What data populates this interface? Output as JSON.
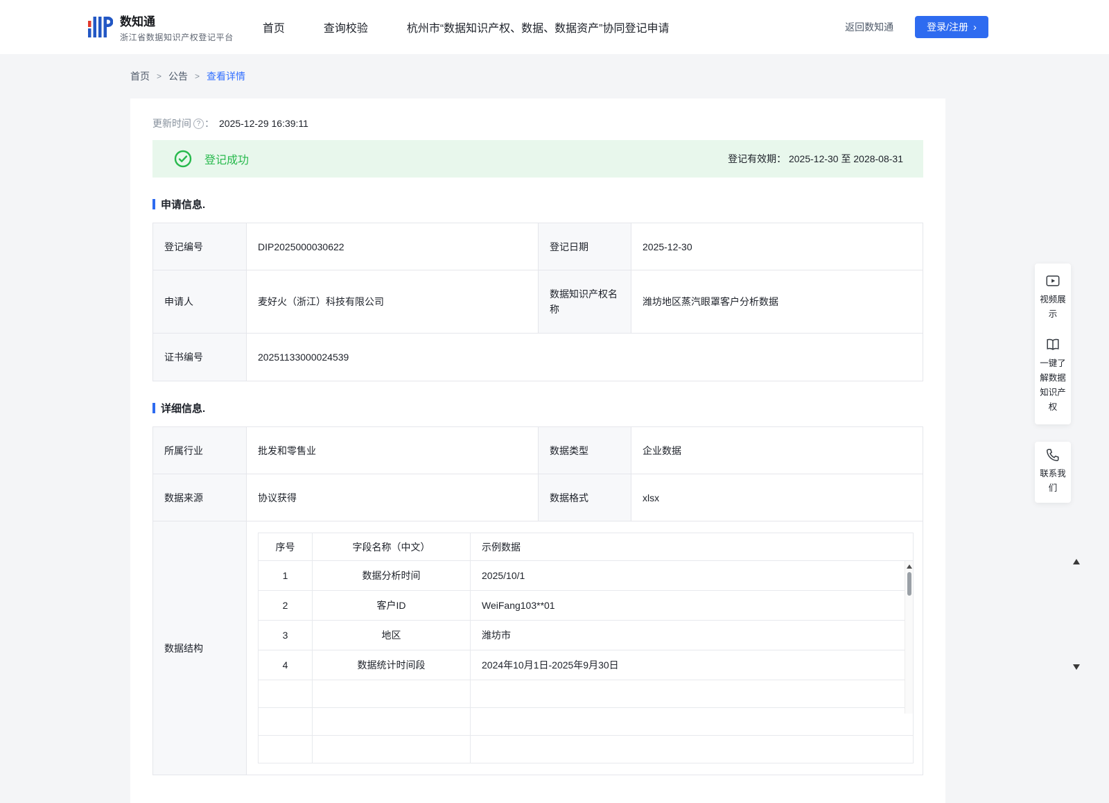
{
  "colors": {
    "accent": "#2e6bf0",
    "success_green": "#27b94c",
    "success_bg": "#e8f7ec"
  },
  "header": {
    "logo_title": "数知通",
    "logo_subtitle": "浙江省数据知识产权登记平台",
    "nav": [
      {
        "label": "首页"
      },
      {
        "label": "查询校验"
      },
      {
        "label": "杭州市“数据知识产权、数据、数据资产”协同登记申请"
      }
    ],
    "back_link": "返回数知通",
    "login_label": "登录/注册",
    "login_arrow": "›"
  },
  "breadcrumb": {
    "home": "首页",
    "sep": ">",
    "section": "公告",
    "current": "查看详情"
  },
  "meta": {
    "update_label": "更新时间",
    "help_glyph": "?",
    "colon": "：",
    "update_time": "2025-12-29 16:39:11"
  },
  "status": {
    "text": "登记成功",
    "validity_label": "登记有效期：",
    "validity_value": "2025-12-30 至 2028-08-31"
  },
  "apply_section": {
    "title": "申请信息.",
    "rows": [
      {
        "l1": "登记编号",
        "v1": "DIP2025000030622",
        "l2": "登记日期",
        "v2": "2025-12-30"
      },
      {
        "l1": "申请人",
        "v1": "麦好火（浙江）科技有限公司",
        "l2": "数据知识产权名称",
        "v2": "潍坊地区蒸汽眼罩客户分析数据"
      },
      {
        "l1": "证书编号",
        "v1": "20251133000024539"
      }
    ]
  },
  "detail_section": {
    "title": "详细信息.",
    "rows": [
      {
        "l1": "所属行业",
        "v1": "批发和零售业",
        "l2": "数据类型",
        "v2": "企业数据"
      },
      {
        "l1": "数据来源",
        "v1": "协议获得",
        "l2": "数据格式",
        "v2": "xlsx"
      }
    ],
    "structure_label": "数据结构",
    "structure_table": {
      "headers": [
        "序号",
        "字段名称（中文）",
        "示例数据"
      ],
      "rows": [
        {
          "no": "1",
          "field": "数据分析时间",
          "sample": "2025/10/1"
        },
        {
          "no": "2",
          "field": "客户ID",
          "sample": "WeiFang103**01"
        },
        {
          "no": "3",
          "field": "地区",
          "sample": "潍坊市"
        },
        {
          "no": "4",
          "field": "数据统计时间段",
          "sample": "2024年10月1日-2025年9月30日"
        }
      ]
    }
  },
  "side_panel": {
    "video_label": "视频展示",
    "guide_label": "一键了解数据知识产权",
    "contact_label": "联系我们"
  }
}
